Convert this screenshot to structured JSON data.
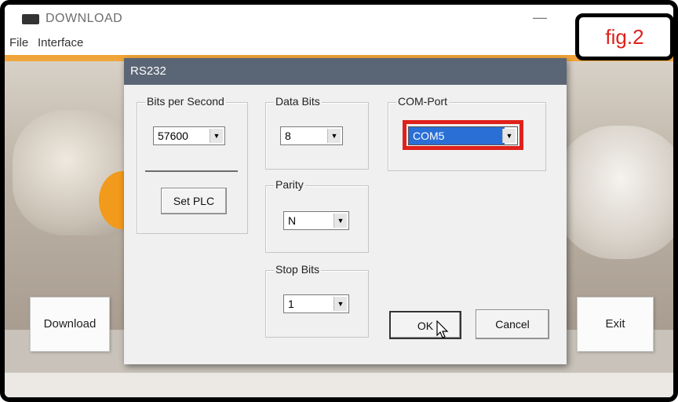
{
  "window": {
    "title": "DOWNLOAD",
    "minimize_glyph": "—"
  },
  "menu": [
    "File",
    "Interface"
  ],
  "buttons": {
    "download": "Download",
    "exit": "Exit"
  },
  "dialog": {
    "title": "RS232",
    "bits_per_second": {
      "label": "Bits per Second",
      "value": "57600"
    },
    "set_plc": "Set PLC",
    "data_bits": {
      "label": "Data Bits",
      "value": "8"
    },
    "parity": {
      "label": "Parity",
      "value": "N"
    },
    "stop_bits": {
      "label": "Stop Bits",
      "value": "1"
    },
    "com_port": {
      "label": "COM-Port",
      "value": "COM5"
    },
    "ok": "OK",
    "cancel": "Cancel"
  },
  "annotation": {
    "label": "fig.2",
    "highlight_color": "#e0211b"
  },
  "icons": [
    "app-icon",
    "dropdown-arrow-icon",
    "mouse-cursor-icon"
  ]
}
